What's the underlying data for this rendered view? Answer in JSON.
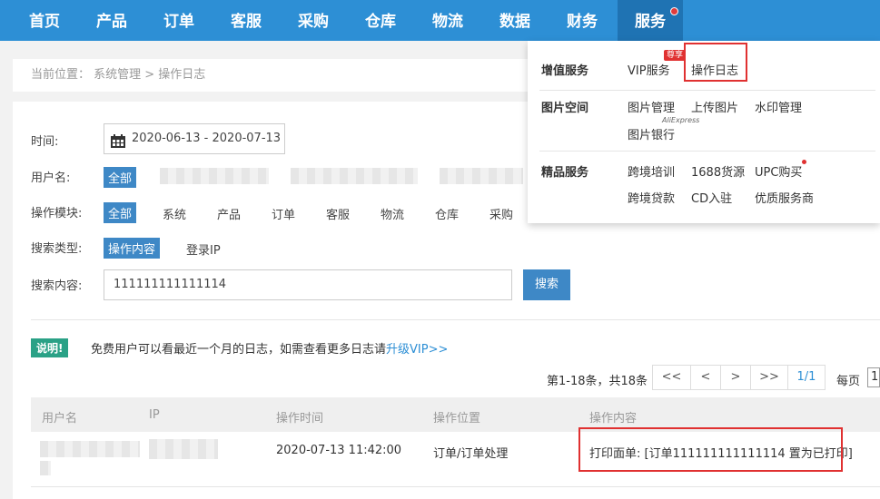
{
  "nav": {
    "items": [
      "首页",
      "产品",
      "订单",
      "客服",
      "采购",
      "仓库",
      "物流",
      "数据",
      "财务",
      "服务"
    ]
  },
  "breadcrumb": {
    "text": "当前位置： 系统管理 > 操作日志"
  },
  "filters": {
    "time_label": "时间:",
    "date_range": "2020-06-13 - 2020-07-13",
    "user_label": "用户名:",
    "user_all": "全部",
    "module_label": "操作模块:",
    "module_options": [
      "全部",
      "系统",
      "产品",
      "订单",
      "客服",
      "物流",
      "仓库",
      "采购"
    ],
    "search_type_label": "搜索类型:",
    "search_type_options": [
      "操作内容",
      "登录IP"
    ],
    "search_content_label": "搜索内容:",
    "search_value": "111111111111114",
    "search_button": "搜索"
  },
  "notice": {
    "tag": "说明!",
    "text": "免费用户可以看最近一个月的日志，如需查看更多日志请",
    "link": "升级VIP>>"
  },
  "pager": {
    "summary": "第1-18条，共18条",
    "first": "<<",
    "prev": "<",
    "next": ">",
    "last": ">>",
    "page": "1/1",
    "per_page_label": "每页",
    "per_page_value": "1"
  },
  "table": {
    "headers": [
      "用户名",
      "IP",
      "操作时间",
      "操作位置",
      "操作内容"
    ],
    "rows": [
      {
        "time": "2020-07-13 11:42:00",
        "location": "订单/订单处理",
        "content": "打印面单: [订单111111111111114 置为已打印]"
      }
    ]
  },
  "dropdown": {
    "sections": [
      {
        "title": "增值服务",
        "items": [
          "VIP服务",
          "操作日志"
        ],
        "badge": "尊享"
      },
      {
        "title": "图片空间",
        "items": [
          "图片管理",
          "上传图片",
          "水印管理",
          "图片银行"
        ],
        "sub_label": "AliExpress"
      },
      {
        "title": "精品服务",
        "items": [
          "跨境培训",
          "1688货源",
          "UPC购买",
          "跨境贷款",
          "CD入驻",
          "优质服务商"
        ]
      }
    ]
  },
  "colors": {
    "nav": "#2d8fd5",
    "accent": "#3e88c6",
    "highlight": "#e03131",
    "notice": "#2aa186"
  }
}
